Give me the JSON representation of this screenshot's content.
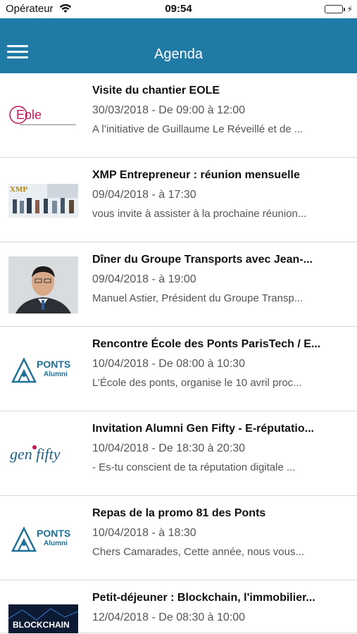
{
  "status_bar": {
    "carrier": "Opérateur",
    "time": "09:54",
    "battery_level": 1.0
  },
  "header": {
    "title": "Agenda",
    "menu_icon": "hamburger-menu-icon",
    "background": "#1f7aa5"
  },
  "events": [
    {
      "title": "Visite du chantier EOLE",
      "date": "30/03/2018 - De 09:00 à 12:00",
      "description": "A l’initiative de Guillaume Le Réveillé et de ...",
      "logo": "Eole"
    },
    {
      "title": "XMP Entrepreneur : réunion mensuelle",
      "date": "09/04/2018 - à 17:30",
      "description": " vous invite à assister à la prochaine réunion...",
      "logo": "XMP"
    },
    {
      "title": "Dîner du Groupe Transports avec Jean-...",
      "date": "09/04/2018 - à 19:00",
      "description": "Manuel Astier, Président du Groupe Transp...",
      "logo": ""
    },
    {
      "title": "Rencontre École des Ponts ParisTech / E...",
      "date": "10/04/2018 - De 08:00 à 10:30",
      "description": "L’École des ponts, organise le 10 avril proc...",
      "logo": "PONTS",
      "logo_sub": "Alumni"
    },
    {
      "title": "Invitation Alumni Gen Fifty - E-réputatio...",
      "date": "10/04/2018 - De 18:30 à 20:30",
      "description": "- Es-tu conscient de ta réputation digitale ...",
      "logo": "gen fifty"
    },
    {
      "title": "Repas de la promo 81 des Ponts",
      "date": "10/04/2018 - à 18:30",
      "description": "Chers Camarades, Cette année, nous vous...",
      "logo": "PONTS",
      "logo_sub": "Alumni"
    },
    {
      "title": "Petit-déjeuner : Blockchain, l'immobilier...",
      "date": "12/04/2018 - De 08:30 à 10:00",
      "description": "",
      "logo": "BLOCKCHAIN"
    }
  ]
}
